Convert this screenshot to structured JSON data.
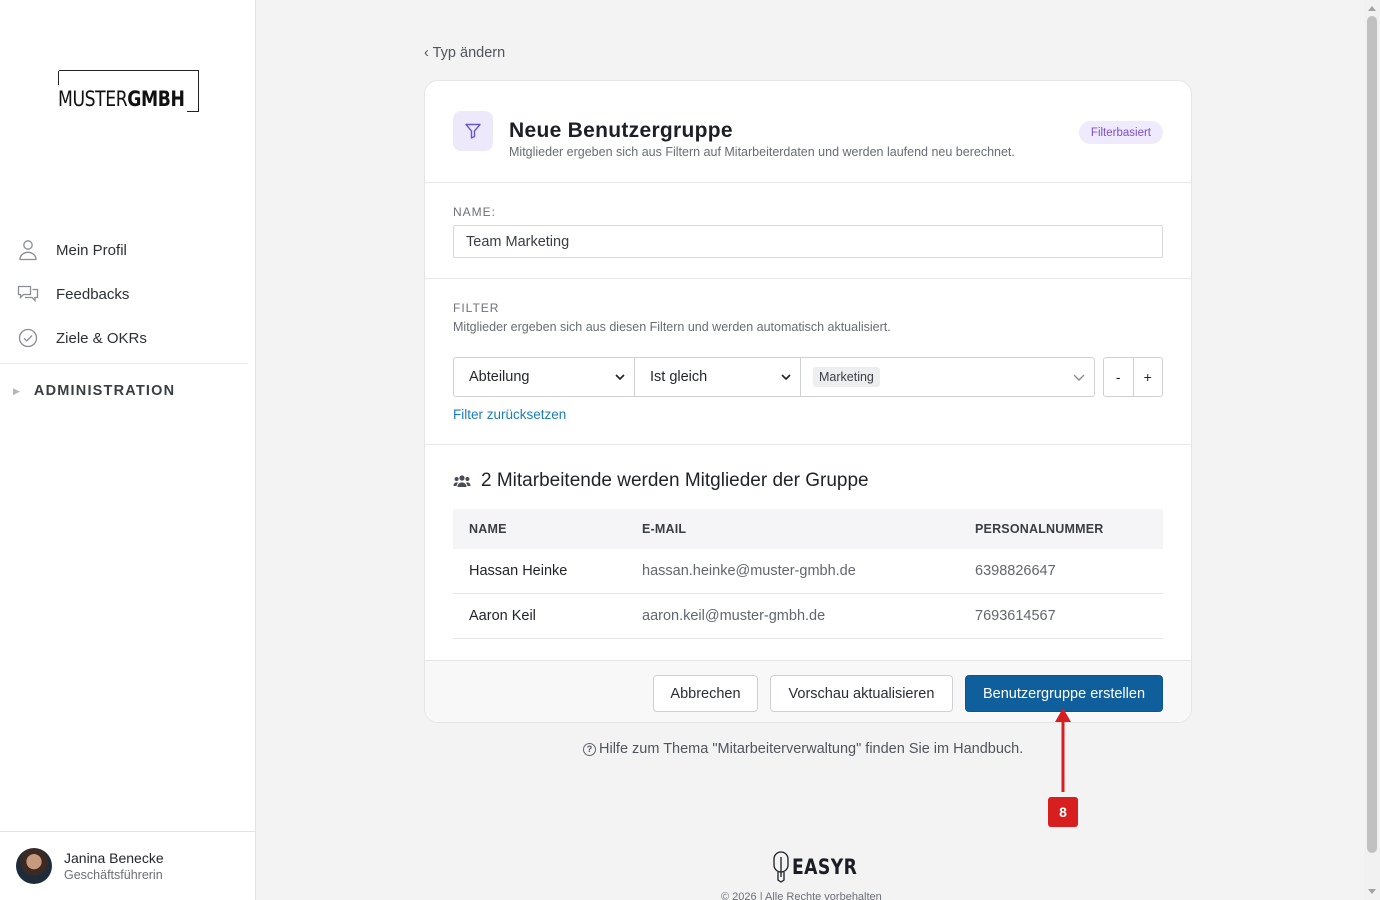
{
  "sidebar": {
    "logo": {
      "light": "MUSTER",
      "bold": "GMBH"
    },
    "items": [
      {
        "label": "Mein Profil",
        "icon": "user-icon"
      },
      {
        "label": "Feedbacks",
        "icon": "feedback-chat-icon"
      },
      {
        "label": "Ziele & OKRs",
        "icon": "check-circle-icon"
      }
    ],
    "admin_label": "ADMINISTRATION",
    "user": {
      "name": "Janina Benecke",
      "role": "Geschäftsführerin"
    }
  },
  "back_link": "Typ ändern",
  "card": {
    "title": "Neue Benutzergruppe",
    "subtitle": "Mitglieder ergeben sich aus Filtern auf Mitarbeiterdaten und werden laufend neu berechnet.",
    "badge": "Filterbasiert",
    "name_label": "NAME:",
    "name_value": "Team Marketing",
    "filter_label": "FILTER",
    "filter_hint": "Mitglieder ergeben sich aus diesen Filtern und werden automatisch aktualisiert.",
    "filter": {
      "field": "Abteilung",
      "operator": "Ist gleich",
      "value": "Marketing",
      "minus": "-",
      "plus": "+"
    },
    "reset_link": "Filter zurücksetzen",
    "members_heading": "2 Mitarbeitende werden Mitglieder der Gruppe",
    "table": {
      "headers": [
        "NAME",
        "E-MAIL",
        "PERSONALNUMMER"
      ],
      "rows": [
        [
          "Hassan Heinke",
          "hassan.heinke@muster-gmbh.de",
          "6398826647"
        ],
        [
          "Aaron Keil",
          "aaron.keil@muster-gmbh.de",
          "7693614567"
        ]
      ]
    },
    "buttons": {
      "cancel": "Abbrechen",
      "preview": "Vorschau aktualisieren",
      "create": "Benutzergruppe erstellen"
    }
  },
  "help_text": "Hilfe zum Thema \"Mitarbeiterverwaltung\" finden Sie im Handbuch.",
  "annotation": {
    "step": "8",
    "color": "#d71f1f"
  },
  "footer": {
    "brand": "EASYR",
    "copyright": "© 2026 | Alle Rechte vorbehalten"
  },
  "colors": {
    "primary": "#0f5f9c",
    "badge": "#7a4fd0",
    "link": "#1a7fb5"
  }
}
